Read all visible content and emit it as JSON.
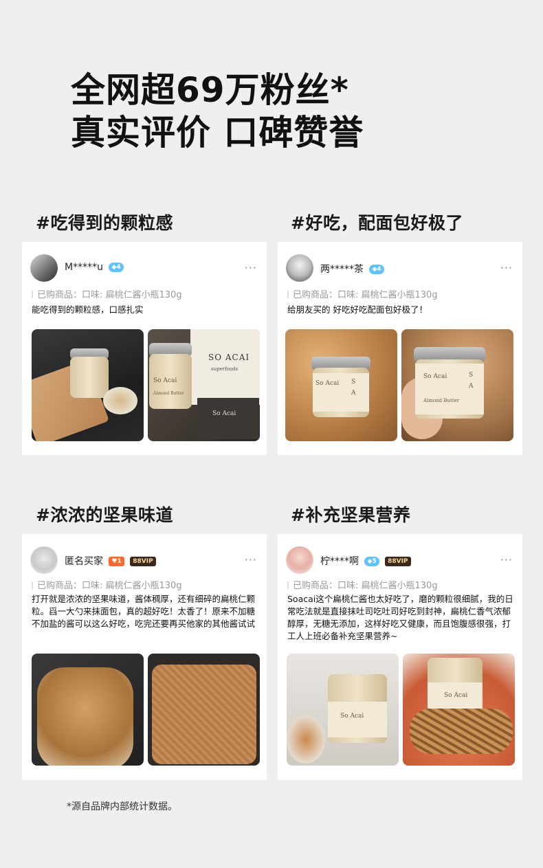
{
  "headline": {
    "line1": "全网超69万粉丝*",
    "line2": "真实评价 口碑赞誉"
  },
  "sections": [
    {
      "tag": "#吃得到的颗粒感",
      "user": "M*****u",
      "diamond_level": "4",
      "product": "已购商品：口味: 扁桃仁酱小瓶130g",
      "review": "能吃得到的颗粒感，口感扎实",
      "photo_texts": [
        "SO ACAI",
        "superfoods",
        "So Acai",
        "So Acai",
        "Almond Butter"
      ]
    },
    {
      "tag": "#好吃，配面包好极了",
      "user": "两*****茶",
      "diamond_level": "4",
      "product": "已购商品：口味: 扁桃仁酱小瓶130g",
      "review": "给朋友买的 好吃好吃配面包好极了！",
      "photo_texts": [
        "So Acai",
        "S",
        "A",
        "Almond Butter"
      ]
    },
    {
      "tag": "#浓浓的坚果味道",
      "user": "匿名买家",
      "level": "1",
      "vip": "88VIP",
      "product": "已购商品：口味: 扁桃仁酱小瓶130g",
      "review": "打开就是浓浓的坚果味道，酱体稠厚，还有细碎的扁桃仁颗粒。舀一大勺来抹面包，真的超好吃！太香了！原来不加糖不加盐的酱可以这么好吃，吃完还要再买他家的其他酱试试"
    },
    {
      "tag": "#补充坚果营养",
      "user": "柠****啊",
      "diamond_level": "5",
      "vip": "88VIP",
      "product": "已购商品：口味: 扁桃仁酱小瓶130g",
      "review": "Soacai这个扁桃仁酱也太好吃了，磨的颗粒很细腻，我的日常吃法就是直接抹吐司吃吐司好吃到封神，扁桃仁香气浓郁醇厚，无糖无添加，这样好吃又健康，而且饱腹感很强，打工人上班必备补充坚果营养~",
      "photo_texts": [
        "So Acai",
        "So Acai"
      ]
    }
  ],
  "more_icon": "···",
  "footnote": "*源自品牌内部统计数据。",
  "colors": {
    "background": "#efefef",
    "card": "#ffffff",
    "diamond": "#5fc3ff",
    "vip": "#3b2a1c"
  }
}
